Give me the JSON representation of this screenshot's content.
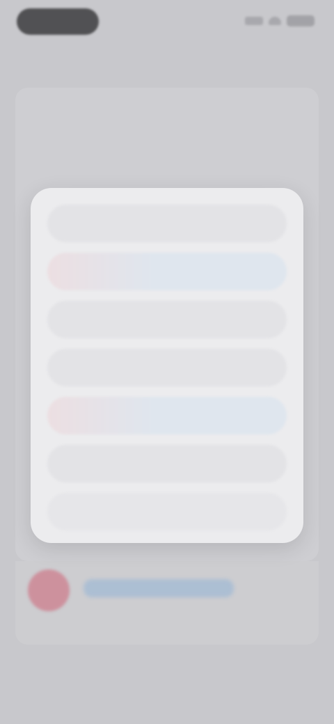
{
  "status_bar": {
    "time": ""
  },
  "nav": {
    "title": ""
  },
  "background": {
    "label_1": "",
    "label_2": "",
    "link_text": "",
    "label_3": ""
  },
  "menu": {
    "items": [
      {
        "label": "",
        "style": "default"
      },
      {
        "label": "",
        "style": "tinted"
      },
      {
        "label": "",
        "style": "default"
      },
      {
        "label": "",
        "style": "default"
      },
      {
        "label": "",
        "style": "tinted"
      },
      {
        "label": "",
        "style": "default"
      },
      {
        "label": "",
        "style": "destructive"
      }
    ]
  },
  "colors": {
    "destructive": "#e0555e",
    "avatar": "#cf7f8e",
    "link": "#5b86b7"
  }
}
